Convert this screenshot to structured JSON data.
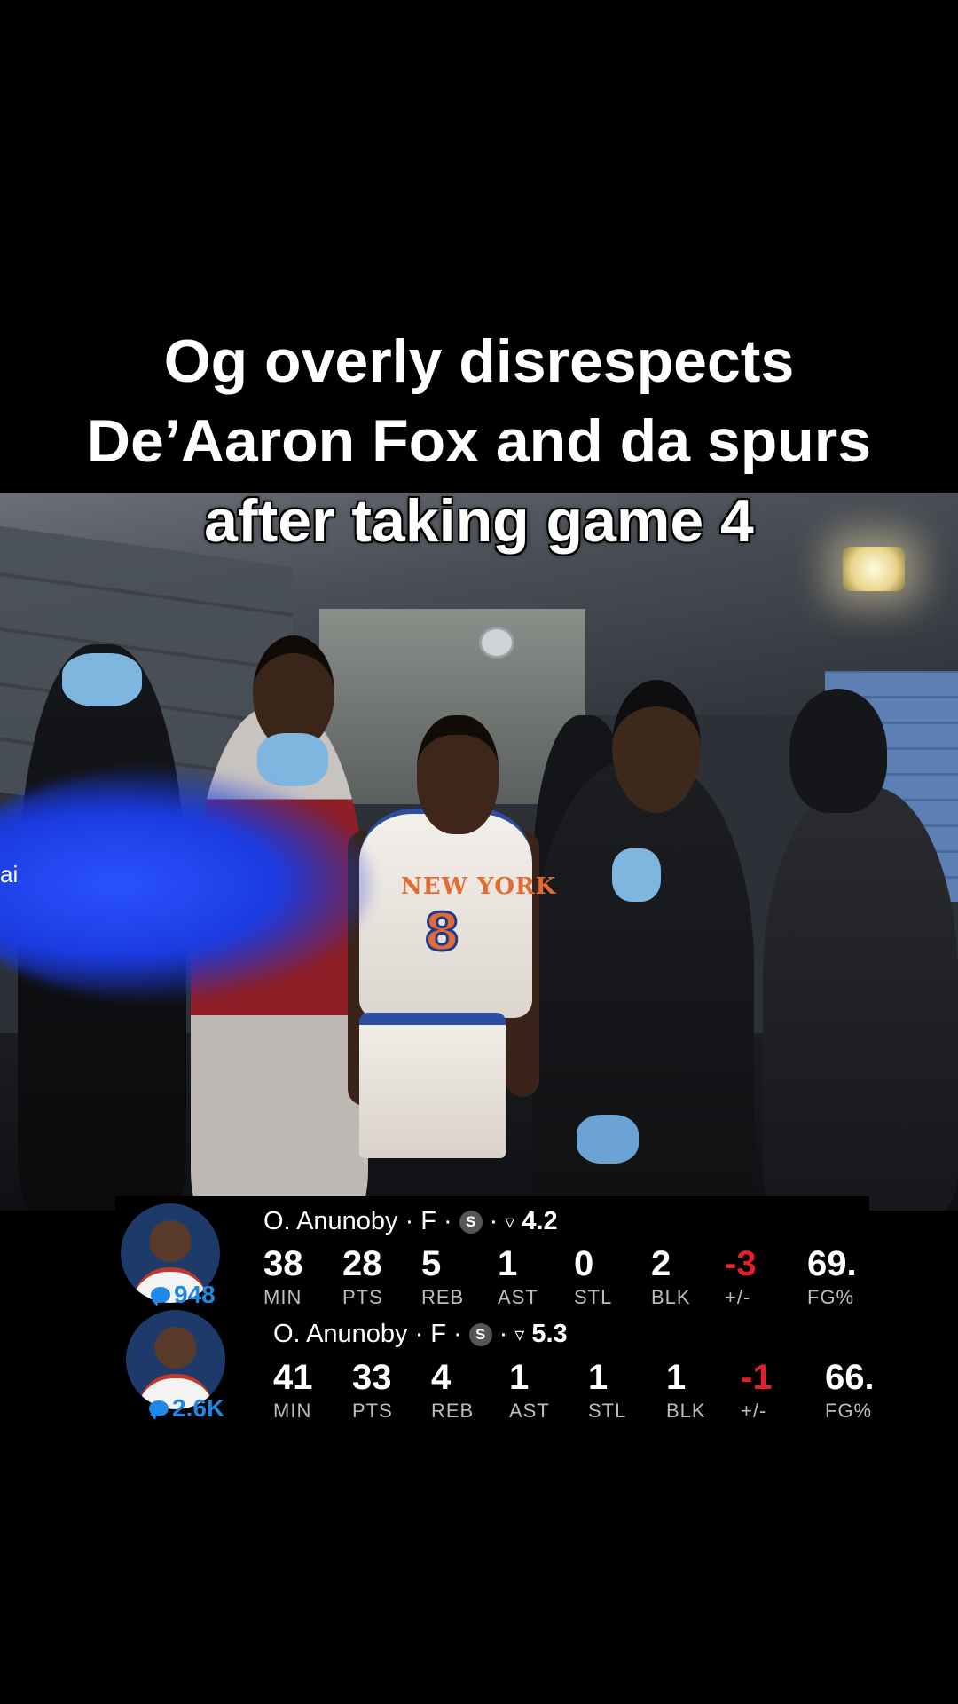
{
  "caption": {
    "line1": "Og overly disrespects",
    "line2": "De’Aaron Fox and da spurs",
    "line3": "after taking game 4"
  },
  "video": {
    "side_label": "ai",
    "jersey_text": "NEW YORK",
    "jersey_number": "8"
  },
  "stat_labels": [
    "MIN",
    "PTS",
    "REB",
    "AST",
    "STL",
    "BLK",
    "+/-",
    "FG%"
  ],
  "rows": [
    {
      "comments": "948",
      "player": "O. Anunoby",
      "position": "F",
      "badge": "S",
      "rating": "4.2",
      "stats": [
        "38",
        "28",
        "5",
        "1",
        "0",
        "2",
        "-3",
        "69."
      ]
    },
    {
      "comments": "2.6K",
      "player": "O. Anunoby",
      "position": "F",
      "badge": "S",
      "rating": "5.3",
      "stats": [
        "41",
        "33",
        "4",
        "1",
        "1",
        "1",
        "-1",
        "66."
      ]
    }
  ],
  "colors": {
    "background": "#000000",
    "comment_blue": "#1e88e5",
    "negative_red": "#e0202a",
    "label_gray": "#bdbdbd"
  },
  "icons": [
    "comment-bubble-icon",
    "s-badge-icon",
    "trend-down-icon"
  ]
}
